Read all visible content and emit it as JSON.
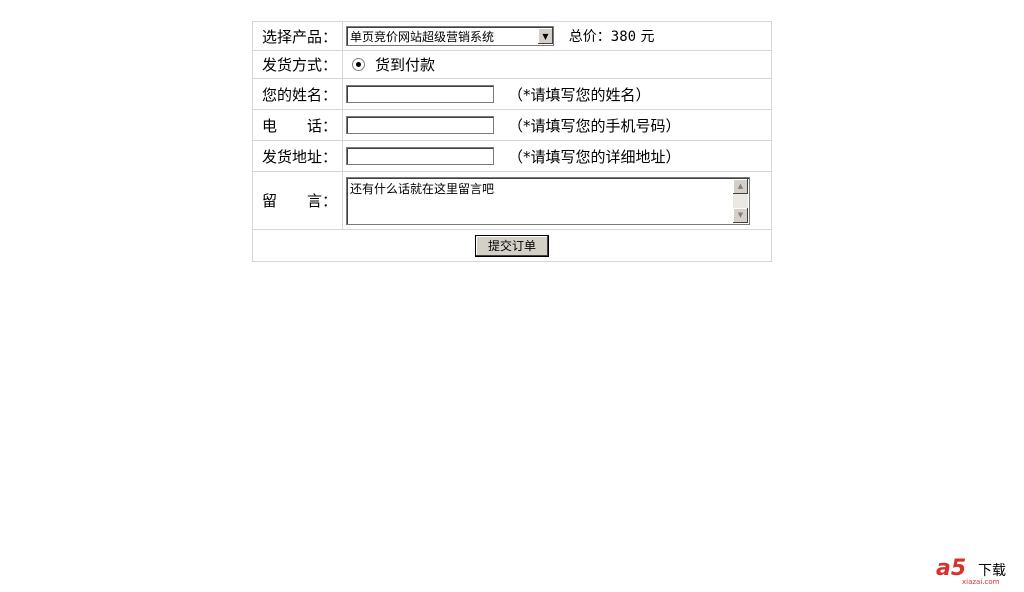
{
  "form": {
    "product_label": "选择产品：",
    "product_selected": "单页竞价网站超级营销系统",
    "price_label": "总价：",
    "price_value": "380",
    "price_unit": "元",
    "shipping_label": "发货方式：",
    "shipping_option": "货到付款",
    "name_label": "您的姓名：",
    "name_value": "",
    "name_hint": "（*请填写您的姓名）",
    "phone_label": "电　　话：",
    "phone_value": "",
    "phone_hint": "（*请填写您的手机号码）",
    "address_label": "发货地址：",
    "address_value": "",
    "address_hint": "（*请填写您的详细地址）",
    "message_label": "留　　言：",
    "message_value": "还有什么话就在这里留言吧",
    "submit_label": "提交订单"
  },
  "watermark": {
    "brand": "a5",
    "text": "下载",
    "url": "xiazai.com"
  },
  "colors": {
    "border": "#d6d6d6",
    "brand_red": "#d9302c",
    "button_face": "#d4d0c8"
  }
}
